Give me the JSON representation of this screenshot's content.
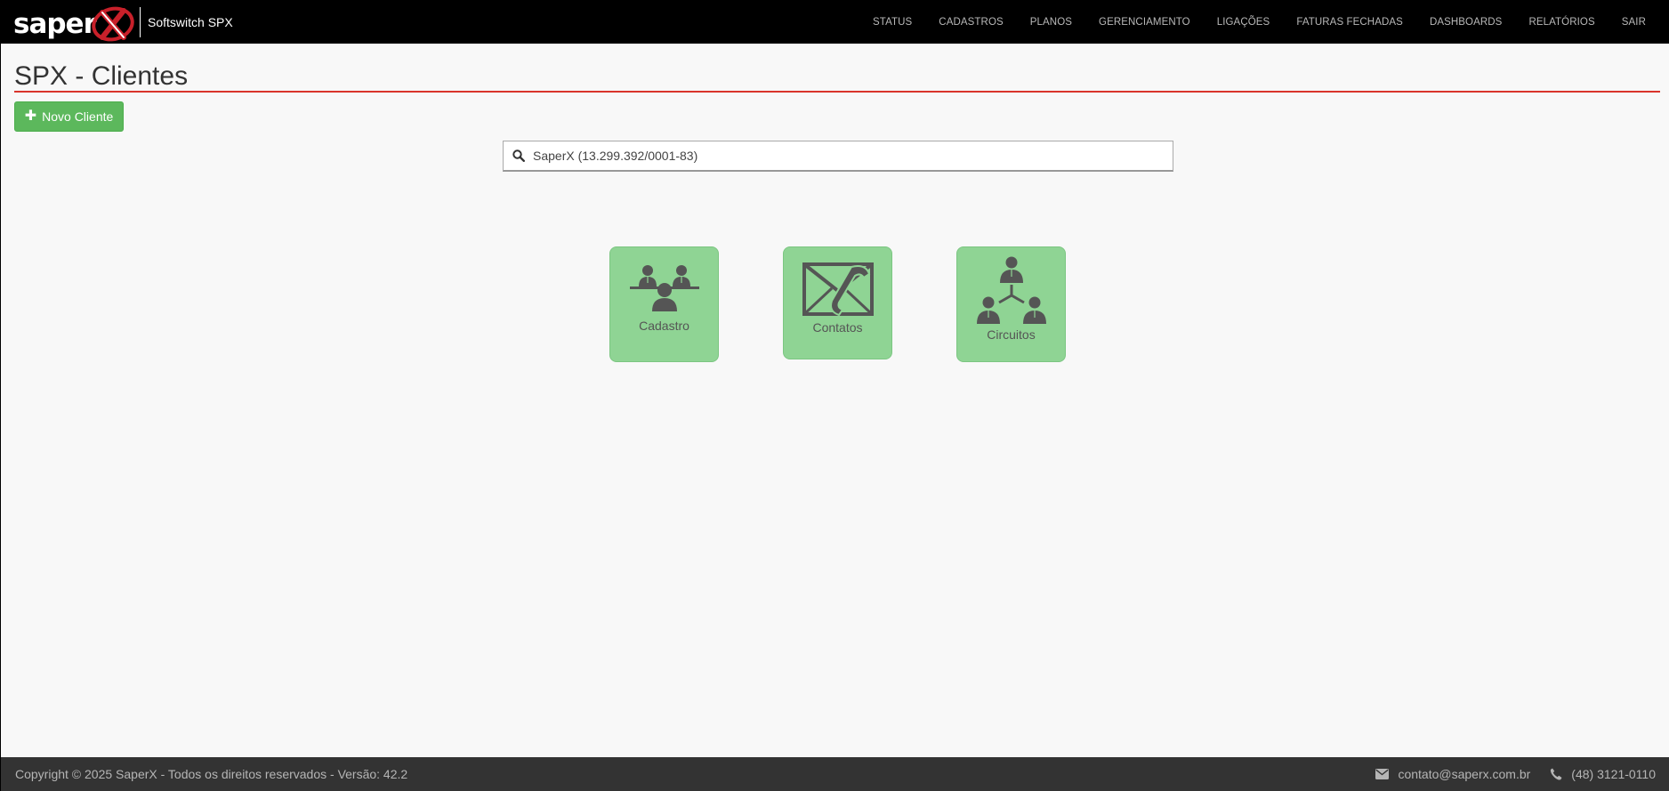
{
  "brand": {
    "logo_text": "saper",
    "product_name": "Softswitch SPX"
  },
  "nav": {
    "items": [
      {
        "label": "STATUS"
      },
      {
        "label": "CADASTROS"
      },
      {
        "label": "PLANOS"
      },
      {
        "label": "GERENCIAMENTO"
      },
      {
        "label": "LIGAÇÕES"
      },
      {
        "label": "FATURAS FECHADAS"
      },
      {
        "label": "DASHBOARDS"
      },
      {
        "label": "RELATÓRIOS"
      },
      {
        "label": "SAIR"
      }
    ]
  },
  "page": {
    "title": "SPX - Clientes",
    "new_button_label": "Novo Cliente",
    "accent_color": "#d9342b"
  },
  "search": {
    "value": "SaperX (13.299.392/0001-83)"
  },
  "tiles": [
    {
      "label": "Cadastro",
      "icon": "people-meeting-icon"
    },
    {
      "label": "Contatos",
      "icon": "envelope-phone-icon"
    },
    {
      "label": "Circuitos",
      "icon": "network-people-icon"
    }
  ],
  "footer": {
    "copyright": "Copyright © 2025 SaperX - Todos os direitos reservados - Versão: 42.2",
    "email": "contato@saperx.com.br",
    "phone": "(48) 3121-0110"
  }
}
